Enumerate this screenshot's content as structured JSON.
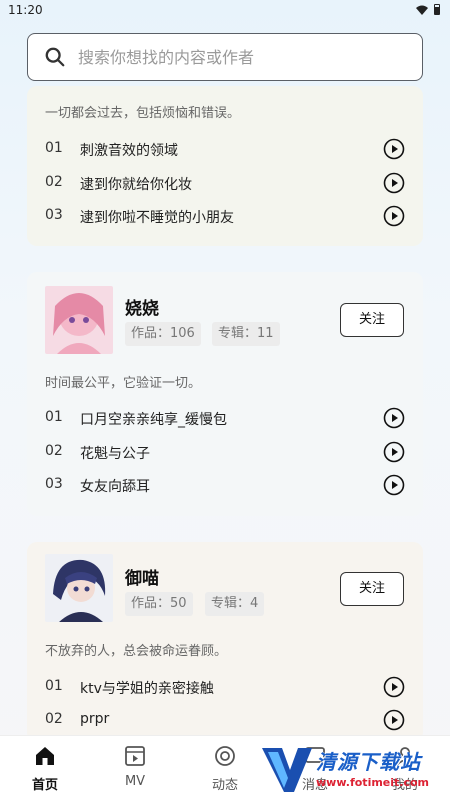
{
  "status": {
    "time": "11:20"
  },
  "search": {
    "placeholder": "搜索你想找的内容或作者"
  },
  "cards": [
    {
      "motto": "一切都会过去，包括烦恼和错误。",
      "tracks": [
        {
          "num": "01",
          "title": "刺激音效的领域"
        },
        {
          "num": "02",
          "title": "逮到你就给你化妆"
        },
        {
          "num": "03",
          "title": "逮到你啦不睡觉的小朋友"
        }
      ]
    },
    {
      "name": "娆娆",
      "works": "作品：106",
      "albums": "专辑：11",
      "follow": "关注",
      "motto": "时间最公平，它验证一切。",
      "tracks": [
        {
          "num": "01",
          "title": "口月空亲亲纯享_缓慢包"
        },
        {
          "num": "02",
          "title": "花魁与公子"
        },
        {
          "num": "03",
          "title": "女友向舔耳"
        }
      ]
    },
    {
      "name": "御喵",
      "works": "作品：50",
      "albums": "专辑：4",
      "follow": "关注",
      "motto": "不放弃的人，总会被命运眷顾。",
      "tracks": [
        {
          "num": "01",
          "title": "ktv与学姐的亲密接触"
        },
        {
          "num": "02",
          "title": "prpr"
        }
      ]
    }
  ],
  "nav": {
    "home": "首页",
    "mv": "MV",
    "dynamic": "动态",
    "messages": "消息",
    "mine": "我的"
  },
  "watermark": {
    "text": "清源下载站",
    "url": "www.fotimeit.com"
  },
  "colors": {
    "card1_bg": "#f4f5ee",
    "card2_bg": "#f4f7f8",
    "card3_bg": "#f7f4ef"
  }
}
